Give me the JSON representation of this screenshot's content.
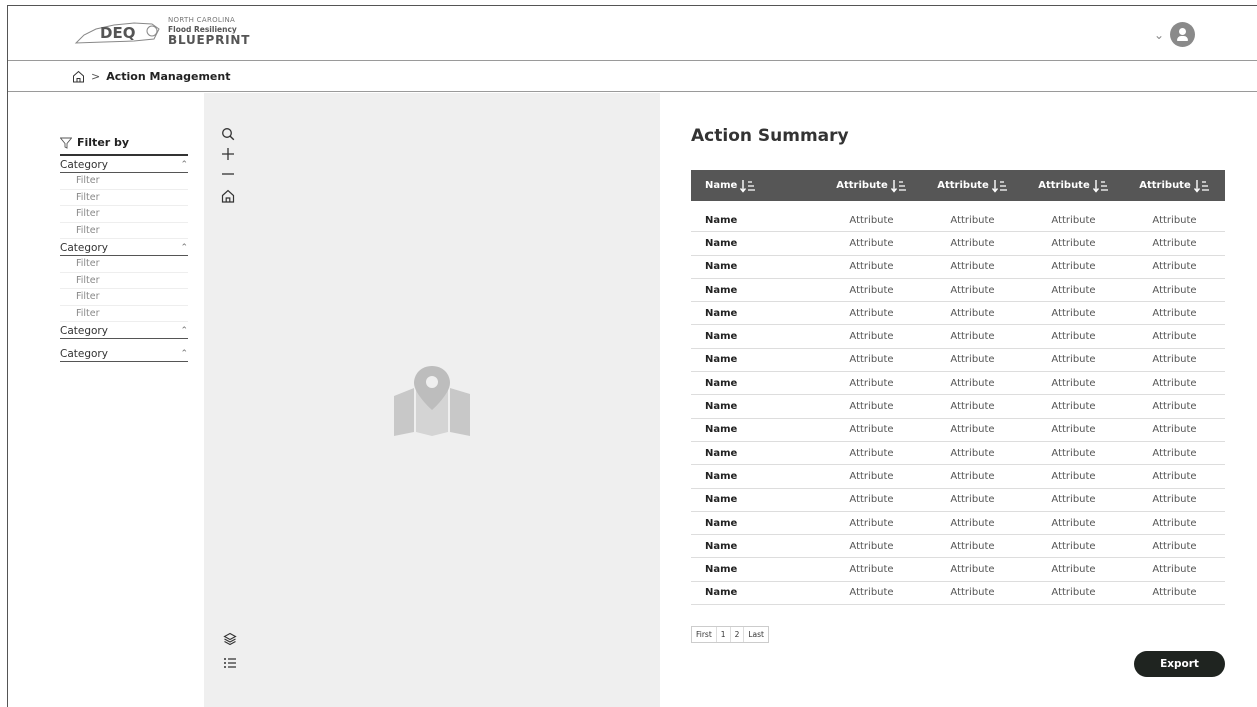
{
  "header": {
    "logo": {
      "mark": "DEQ",
      "line1": "NORTH CAROLINA",
      "line2": "Flood Resiliency",
      "line3": "BLUEPRINT"
    },
    "user_menu_icon": "chevron-down-icon",
    "avatar_icon": "user-avatar-icon"
  },
  "breadcrumb": {
    "home_icon": "home-icon",
    "separator": ">",
    "current": "Action Management"
  },
  "sidebar": {
    "filter_title": "Filter by",
    "categories": [
      {
        "label": "Category",
        "filters": [
          "Filter",
          "Filter",
          "Filter",
          "Filter"
        ]
      },
      {
        "label": "Category",
        "filters": [
          "Filter",
          "Filter",
          "Filter",
          "Filter"
        ]
      },
      {
        "label": "Category",
        "filters": []
      },
      {
        "label": "Category",
        "filters": []
      }
    ]
  },
  "map": {
    "tools": [
      "search-icon",
      "zoom-in-icon",
      "zoom-out-icon",
      "home-icon"
    ],
    "bottom_tools": [
      "layers-icon",
      "list-icon"
    ],
    "placeholder_icon": "map-pin-icon"
  },
  "summary": {
    "title": "Action Summary",
    "columns": [
      "Name",
      "Attribute",
      "Attribute",
      "Attribute",
      "Attribute"
    ],
    "rows": [
      [
        "Name",
        "Attribute",
        "Attribute",
        "Attribute",
        "Attribute"
      ],
      [
        "Name",
        "Attribute",
        "Attribute",
        "Attribute",
        "Attribute"
      ],
      [
        "Name",
        "Attribute",
        "Attribute",
        "Attribute",
        "Attribute"
      ],
      [
        "Name",
        "Attribute",
        "Attribute",
        "Attribute",
        "Attribute"
      ],
      [
        "Name",
        "Attribute",
        "Attribute",
        "Attribute",
        "Attribute"
      ],
      [
        "Name",
        "Attribute",
        "Attribute",
        "Attribute",
        "Attribute"
      ],
      [
        "Name",
        "Attribute",
        "Attribute",
        "Attribute",
        "Attribute"
      ],
      [
        "Name",
        "Attribute",
        "Attribute",
        "Attribute",
        "Attribute"
      ],
      [
        "Name",
        "Attribute",
        "Attribute",
        "Attribute",
        "Attribute"
      ],
      [
        "Name",
        "Attribute",
        "Attribute",
        "Attribute",
        "Attribute"
      ],
      [
        "Name",
        "Attribute",
        "Attribute",
        "Attribute",
        "Attribute"
      ],
      [
        "Name",
        "Attribute",
        "Attribute",
        "Attribute",
        "Attribute"
      ],
      [
        "Name",
        "Attribute",
        "Attribute",
        "Attribute",
        "Attribute"
      ],
      [
        "Name",
        "Attribute",
        "Attribute",
        "Attribute",
        "Attribute"
      ],
      [
        "Name",
        "Attribute",
        "Attribute",
        "Attribute",
        "Attribute"
      ],
      [
        "Name",
        "Attribute",
        "Attribute",
        "Attribute",
        "Attribute"
      ],
      [
        "Name",
        "Attribute",
        "Attribute",
        "Attribute",
        "Attribute"
      ]
    ],
    "pagination": [
      "First",
      "1",
      "2",
      "Last"
    ],
    "export_label": "Export"
  },
  "colors": {
    "header_bg": "#565656",
    "map_bg": "#efefef",
    "export_bg": "#1f2420"
  }
}
